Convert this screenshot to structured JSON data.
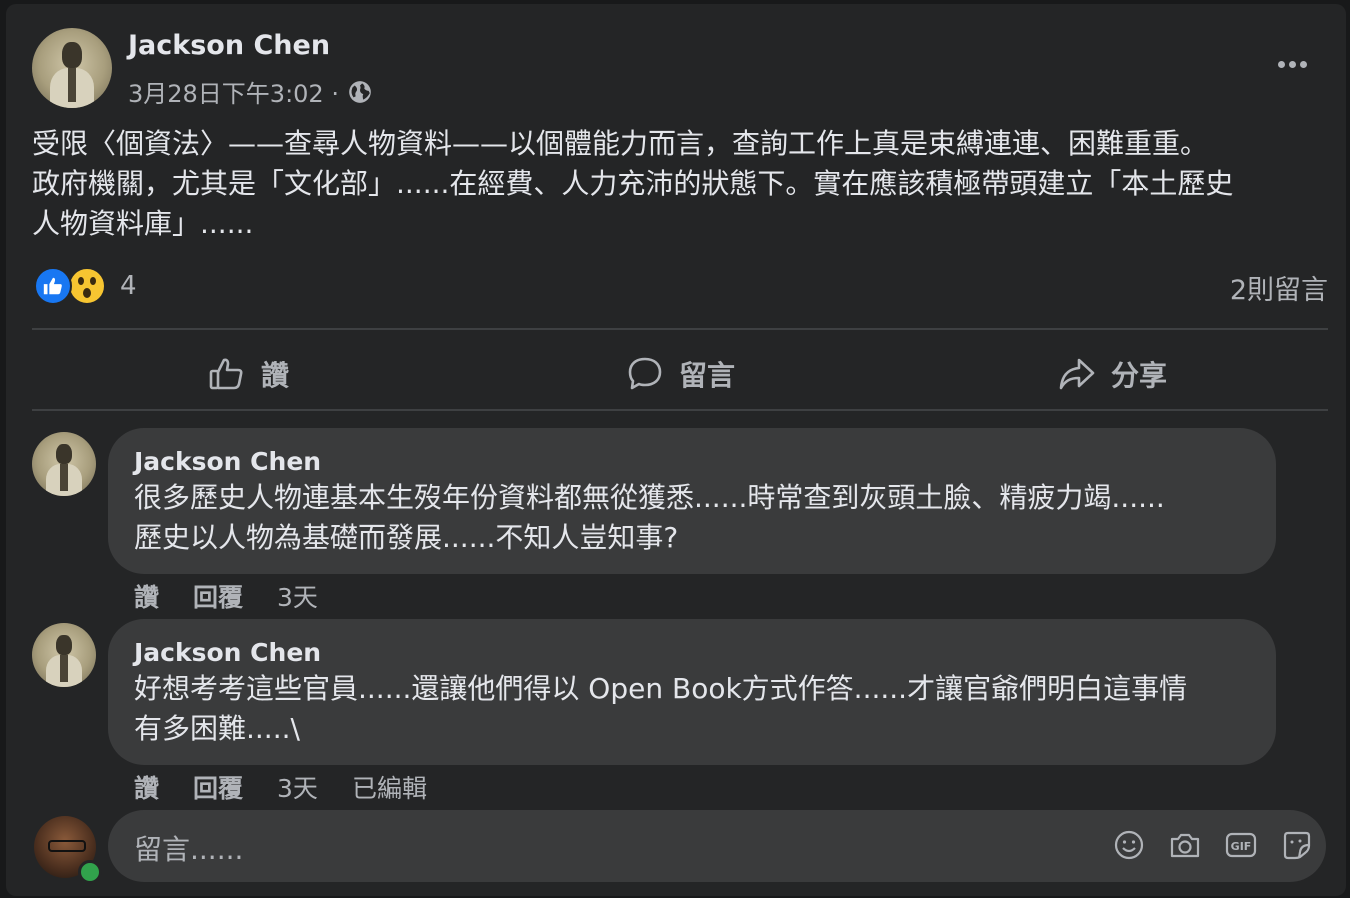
{
  "post": {
    "author": "Jackson Chen",
    "timestamp": "3月28日下午3:02 ·",
    "text": "受限〈個資法〉——查尋人物資料——以個體能力而言，查詢工作上真是束縛連連、困難重重。\n政府機關，尤其是「文化部」......在經費、人力充沛的狀態下。實在應該積極帶頭建立「本土歷史\n人物資料庫」......",
    "reaction_count": "4",
    "comment_count": "2則留言"
  },
  "actions": {
    "like": "讚",
    "comment": "留言",
    "share": "分享"
  },
  "comments": [
    {
      "author": "Jackson Chen",
      "text": "很多歷史人物連基本生歿年份資料都無從獲悉......時常查到灰頭土臉、精疲力竭......\n歷史以人物為基礎而發展......不知人豈知事?",
      "like": "讚",
      "reply": "回覆",
      "time": "3天"
    },
    {
      "author": "Jackson Chen",
      "text": "好想考考這些官員......還讓他們得以 Open Book方式作答......才讓官爺們明白這事情\n有多困難.....\\",
      "like": "讚",
      "reply": "回覆",
      "time": "3天",
      "edited": "已編輯"
    }
  ],
  "composer": {
    "placeholder": "留言......"
  },
  "colors": {
    "background": "#242526",
    "bubble": "#3a3b3c",
    "text": "#e4e6eb",
    "secondary": "#b0b3b8",
    "like_blue": "#1877f2",
    "online_green": "#31a24c"
  }
}
